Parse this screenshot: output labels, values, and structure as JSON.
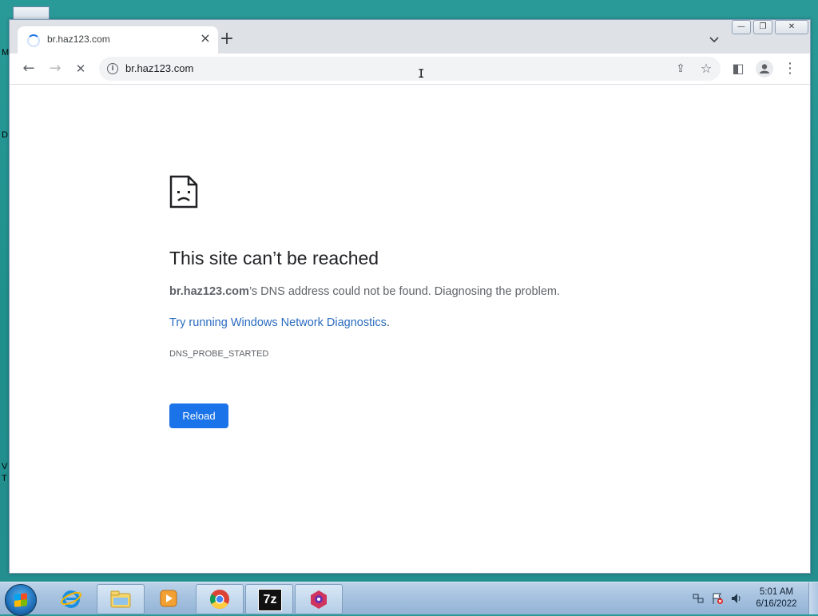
{
  "desktop": {
    "edge_letters": [
      "M",
      "D",
      "V",
      "T"
    ]
  },
  "browser": {
    "tab": {
      "title": "br.haz123.com",
      "close_glyph": "×"
    },
    "new_tab_glyph": "+",
    "tab_list_glyph": "⌄",
    "window_buttons": {
      "minimize": "—",
      "maximize": "❐",
      "close": "✕"
    },
    "toolbar": {
      "back_glyph": "←",
      "forward_glyph": "→",
      "stop_glyph": "✕",
      "url": "br.haz123.com",
      "info_glyph": "i",
      "share_glyph": "⇪",
      "bookmark_glyph": "☆",
      "sidepanel_glyph": "◧",
      "profile_glyph": "●",
      "menu_glyph": "⋮"
    },
    "cursor_glyph": "I",
    "error_page": {
      "title": "This site can’t be reached",
      "host": "br.haz123.com",
      "message_rest": "’s DNS address could not be found. Diagnosing the problem.",
      "link_text": "Try running Windows Network Diagnostics",
      "link_suffix": ".",
      "error_code": "DNS_PROBE_STARTED",
      "reload_label": "Reload"
    }
  },
  "taskbar": {
    "apps": [
      {
        "name": "Internet Explorer",
        "icon": "ie-icon"
      },
      {
        "name": "Windows Explorer",
        "icon": "folder-icon"
      },
      {
        "name": "Windows Media Player",
        "icon": "media-player-icon"
      },
      {
        "name": "Google Chrome",
        "icon": "chrome-icon"
      },
      {
        "name": "7-Zip",
        "icon": "7zip-icon",
        "label": "7z"
      },
      {
        "name": "App",
        "icon": "app-icon"
      }
    ],
    "clock": {
      "time": "5:01 AM",
      "date": "6/16/2022"
    }
  },
  "colors": {
    "accent": "#1a73e8",
    "link": "#2a6bbf",
    "desktop": "#2a9a98"
  }
}
